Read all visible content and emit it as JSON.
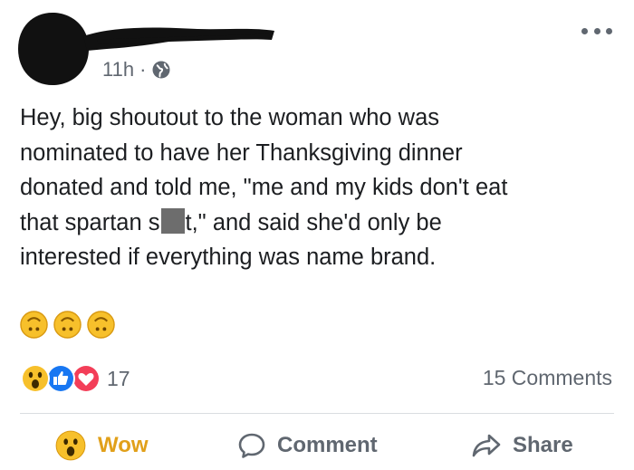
{
  "post": {
    "time": "11h",
    "separator": "·",
    "text_line1": "Hey, big shoutout to the woman who was",
    "text_line2": "nominated to have her Thanksgiving dinner",
    "text_line3": "donated and told me, \"me and my kids don't eat",
    "text_line4_start": "that spartan s",
    "text_line4_end": "t,\" and said she'd only be",
    "text_line5": "interested if everything was name brand.",
    "emoji_row": [
      "upside-down-face",
      "upside-down-face",
      "upside-down-face"
    ]
  },
  "reactions": {
    "icons": [
      "wow-icon",
      "like-icon",
      "love-icon"
    ],
    "count": "17",
    "comments_label": "15 Comments"
  },
  "actions": {
    "wow_label": "Wow",
    "comment_label": "Comment",
    "share_label": "Share"
  },
  "colors": {
    "text": "#1c1e21",
    "secondary": "#606770",
    "wow": "#e1a01a",
    "like": "#1877f2",
    "love": "#f33e58",
    "divider": "#dadde1"
  }
}
